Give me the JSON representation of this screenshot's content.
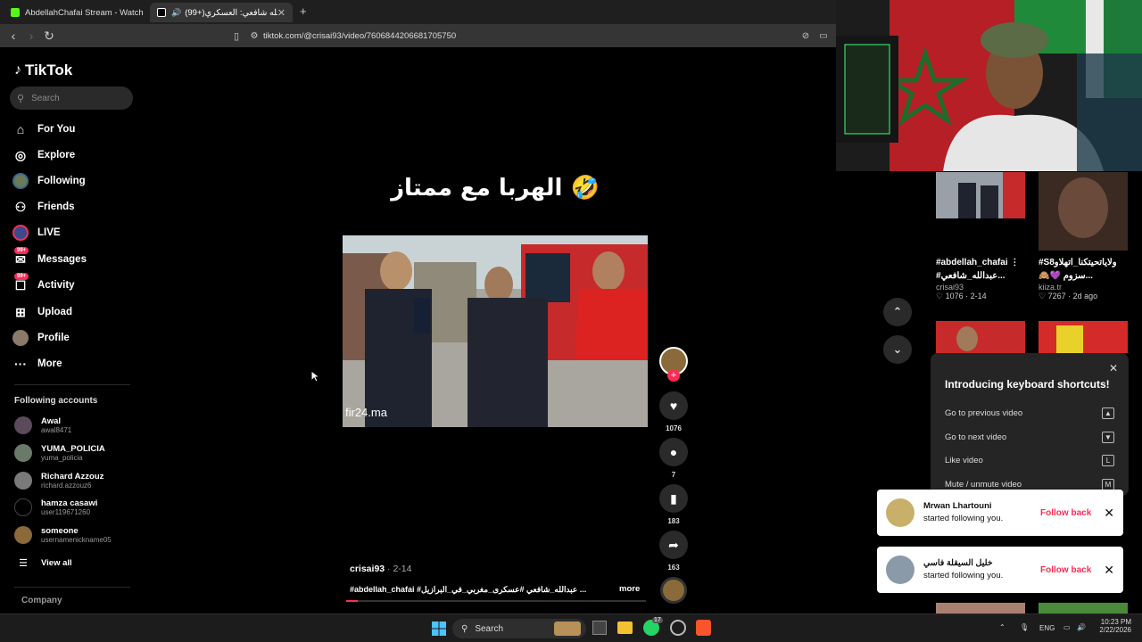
{
  "browser": {
    "tabs": [
      {
        "label": "AbdellahChafai Stream - Watch Live on",
        "favicon_color": "#53fc18"
      },
      {
        "label": "(99+)عبد الله شافعي: العسكري",
        "favicon_color": "#000000"
      }
    ],
    "new_tab": "+",
    "url": "tiktok.com/@crisai93/video/7606844206681705750"
  },
  "sidebar": {
    "logo": "TikTok",
    "search_placeholder": "Search",
    "nav": [
      {
        "label": "For You",
        "icon": "home-icon"
      },
      {
        "label": "Explore",
        "icon": "compass-icon"
      },
      {
        "label": "Following",
        "icon": "avatar-icon"
      },
      {
        "label": "Friends",
        "icon": "friends-icon"
      },
      {
        "label": "LIVE",
        "icon": "live-icon"
      },
      {
        "label": "Messages",
        "icon": "message-icon",
        "badge": "99+"
      },
      {
        "label": "Activity",
        "icon": "activity-icon",
        "badge": "99+"
      },
      {
        "label": "Upload",
        "icon": "upload-icon"
      },
      {
        "label": "Profile",
        "icon": "profile-icon"
      },
      {
        "label": "More",
        "icon": "more-icon"
      }
    ],
    "following_title": "Following accounts",
    "accounts": [
      {
        "name": "Awal",
        "handle": "awal8471"
      },
      {
        "name": "YUMA_POLICIA",
        "handle": "yuma_policia"
      },
      {
        "name": "Richard Azzouz",
        "handle": "richard.azzouz6"
      },
      {
        "name": "hamza casawi",
        "handle": "user119671260"
      },
      {
        "name": "someone",
        "handle": "usernamenickname05"
      }
    ],
    "view_all": "View all",
    "company": "Company"
  },
  "video": {
    "overlay_text": "الهربا مع ممتاز 🤣",
    "watermark": "fir24.ma",
    "author": "crisai93",
    "date": "2-14",
    "description": "#abdellah_chafai #عبدالله_شافعي #عسكرى_مغربي_في_البرازيل ...",
    "more": "more",
    "progress": 0.04,
    "actions": {
      "likes": "1076",
      "comments": "7",
      "saves": "183",
      "shares": "163"
    }
  },
  "related": [
    {
      "title": "#abdellah_chafai ⋮",
      "title2": "#عبدالله_شافعي...",
      "user": "crisai93",
      "likes": "1076",
      "date": "2-14"
    },
    {
      "title": "#S8ولاياتحيتكنا_اتهلاو",
      "title2": "🙈💜 سزوم...",
      "user": "kiiza.tr",
      "likes": "7267",
      "date": "2d ago"
    }
  ],
  "keyboard_shortcuts": {
    "title": "Introducing keyboard shortcuts!",
    "rows": [
      {
        "label": "Go to previous video",
        "key": "▲"
      },
      {
        "label": "Go to next video",
        "key": "▼"
      },
      {
        "label": "Like video",
        "key": "L"
      },
      {
        "label": "Mute / unmute video",
        "key": "M"
      }
    ]
  },
  "notifications": [
    {
      "name": "Mrwan Lhartouni",
      "text": "started following you.",
      "action": "Follow back"
    },
    {
      "name": "خليل السيقلة فاسي",
      "text": "started following you.",
      "action": "Follow back"
    }
  ],
  "taskbar": {
    "search": "Search",
    "whatsapp_badge": "17",
    "lang": "ENG",
    "time": "10:23 PM",
    "date": "2/22/2026"
  },
  "colors": {
    "accent": "#fe2c55",
    "bg": "#000000",
    "panel": "#252525"
  }
}
